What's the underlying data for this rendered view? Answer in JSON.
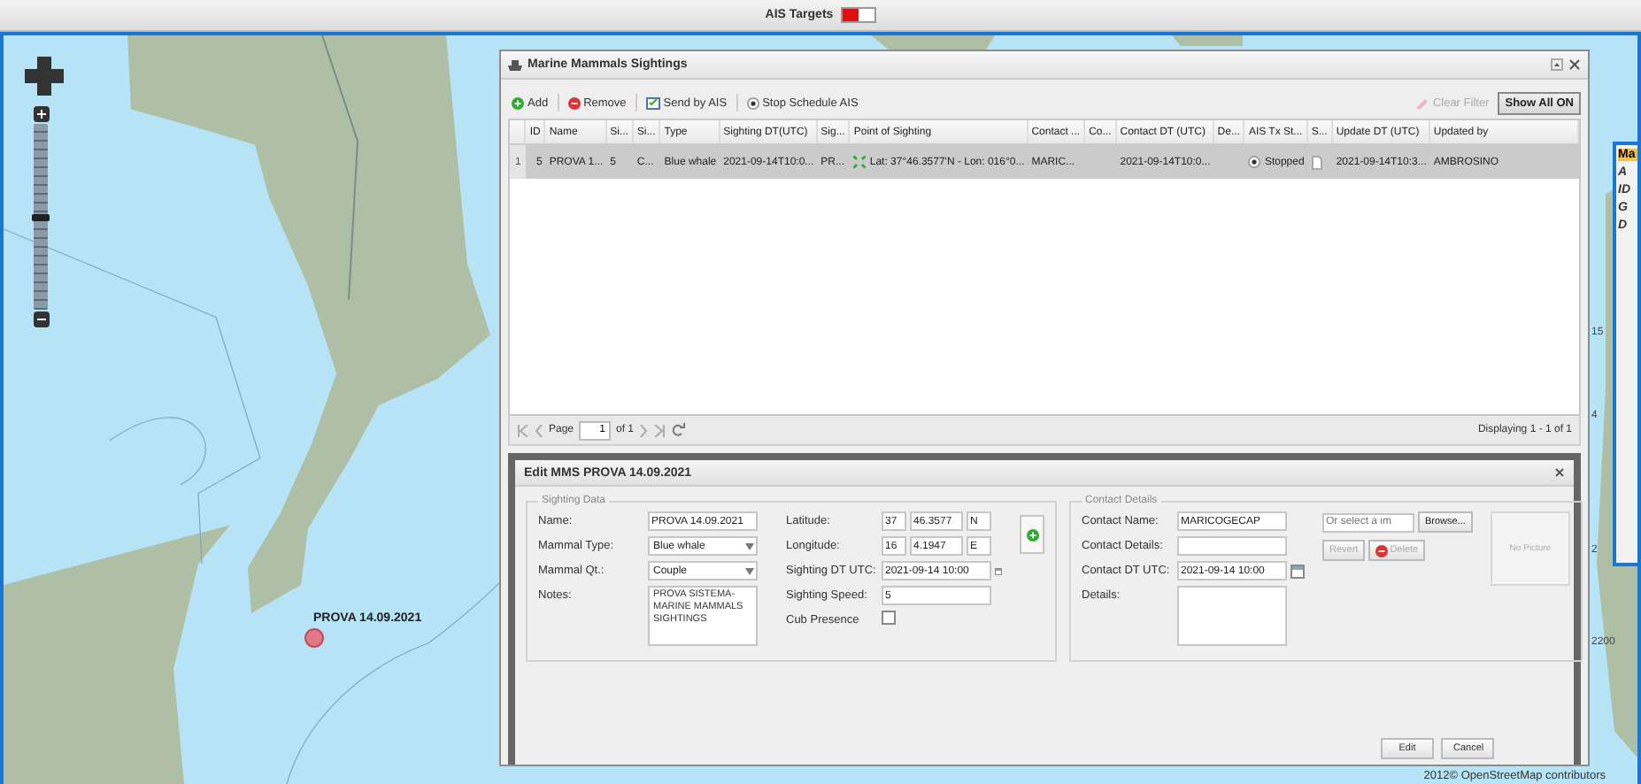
{
  "top_bar": {
    "label": "AIS Targets",
    "toggle_on": true
  },
  "map": {
    "zoom_slider": {
      "level": 0.5
    },
    "marker": {
      "label": "PROVA 14.09.2021"
    },
    "grid_labels": [
      "15",
      "4",
      "2",
      "2200"
    ],
    "attribution": "2012© OpenStreetMap contributors"
  },
  "sightings_window": {
    "title": "Marine Mammals Sightings",
    "toolbar": [
      {
        "kind": "add",
        "label": "Add"
      },
      {
        "kind": "remove",
        "label": "Remove"
      },
      {
        "kind": "send",
        "label": "Send by AIS"
      },
      {
        "kind": "stop",
        "label": "Stop Schedule AIS"
      }
    ],
    "clear_filter": {
      "label": "Clear Filter",
      "disabled": true
    },
    "show_all": {
      "label": "Show All ON"
    },
    "table": {
      "columns": [
        {
          "label": "ID",
          "kind": "number"
        },
        {
          "label": "Name",
          "kind": "text"
        },
        {
          "label": "Si...",
          "kind": "text"
        },
        {
          "label": "Si...",
          "kind": "text"
        },
        {
          "label": "Type",
          "kind": "text"
        },
        {
          "label": "Sighting DT(UTC)",
          "kind": "text"
        },
        {
          "label": "Sig...",
          "kind": "text"
        },
        {
          "label": "Point of Sighting",
          "kind": "position"
        },
        {
          "label": "Contact ...",
          "kind": "text"
        },
        {
          "label": "Co...",
          "kind": "text"
        },
        {
          "label": "Contact DT (UTC)",
          "kind": "text"
        },
        {
          "label": "De...",
          "kind": "text"
        },
        {
          "label": "AIS Tx St...",
          "kind": "status"
        },
        {
          "label": "S...",
          "kind": "attachment"
        },
        {
          "label": "Update DT (UTC)",
          "kind": "text"
        },
        {
          "label": "Updated by",
          "kind": "text"
        }
      ],
      "rows": [
        {
          "number": "1",
          "selected": true,
          "cells": [
            "5",
            "PROVA 1...",
            "5",
            "C...",
            "Blue whale",
            "2021-09-14T10:0...",
            "PR...",
            "Lat: 37°46.3577'N - Lon: 016°0...",
            "MARIC...",
            "",
            "2021-09-14T10:0...",
            "",
            "Stopped",
            "",
            "2021-09-14T10:3...",
            "AMBROSINO"
          ]
        }
      ]
    },
    "paging": {
      "page_label": "Page",
      "page": "1",
      "of": "of 1",
      "display": "Displaying 1 - 1 of 1"
    },
    "edit_panel": {
      "title": "Edit MMS PROVA 14.09.2021",
      "sighting": {
        "legend": "Sighting Data",
        "left": [
          {
            "label": "Name:",
            "kind": "text",
            "value": "PROVA 14.09.2021"
          },
          {
            "label": "Mammal Type:",
            "kind": "select",
            "value": "Blue whale"
          },
          {
            "label": "Mammal Qt.:",
            "kind": "select",
            "value": "Couple"
          },
          {
            "label": "Notes:",
            "kind": "textarea",
            "value": "PROVA SISTEMA-MARINE MAMMALS SIGHTINGS"
          }
        ],
        "right": [
          {
            "label": "Latitude:",
            "kind": "coordinate",
            "parts": [
              "37",
              "46.3577",
              "N"
            ]
          },
          {
            "label": "Longitude:",
            "kind": "coordinate",
            "parts": [
              "16",
              "4.1947",
              "E"
            ]
          },
          {
            "label": "Sighting DT UTC:",
            "kind": "date",
            "value": "2021-09-14 10:00"
          },
          {
            "label": "Sighting Speed:",
            "kind": "text",
            "value": "5"
          },
          {
            "label": "Cub Presence",
            "kind": "checkbox",
            "checked": false
          }
        ]
      },
      "contact": {
        "legend": "Contact Details",
        "fields": [
          {
            "label": "Contact Name:",
            "kind": "text",
            "value": "MARICOGECAP"
          },
          {
            "label": "Contact Details:",
            "kind": "text"
          },
          {
            "label": "Contact DT UTC:",
            "kind": "date",
            "value": "2021-09-14 10:00"
          },
          {
            "label": "Details:",
            "kind": "textarea"
          }
        ],
        "file_placeholder": "Or select a im",
        "browse": "Browse...",
        "revert": {
          "label": "Revert",
          "disabled": true
        },
        "delete": {
          "label": "Delete",
          "disabled": true
        },
        "picture": "No Picture"
      },
      "buttons": [
        "Edit",
        "Cancel"
      ]
    }
  },
  "right_panel": {
    "title": "Ma",
    "labels": [
      "A",
      "ID",
      "G",
      "D"
    ]
  }
}
